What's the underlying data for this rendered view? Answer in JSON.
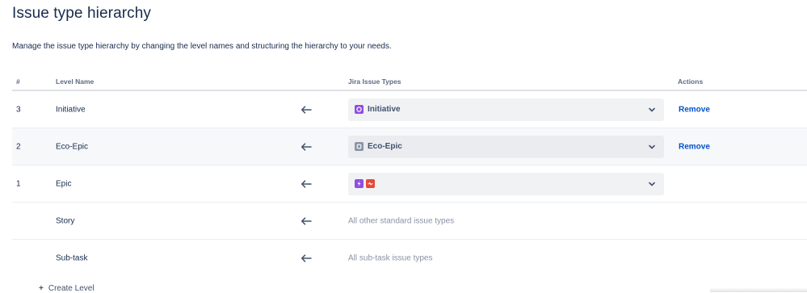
{
  "title": "Issue type hierarchy",
  "description": "Manage the issue type hierarchy by changing the level names and structuring the hierarchy to your needs.",
  "columns": {
    "num": "#",
    "level_name": "Level Name",
    "issue_types": "Jira Issue Types",
    "actions": "Actions"
  },
  "rows": [
    {
      "num": "3",
      "name": "Initiative",
      "arrow_icon": "arrow-left-icon",
      "type_label": "Initiative",
      "type_icons": [
        "initiative-icon"
      ],
      "action": "Remove"
    },
    {
      "num": "2",
      "name": "Eco-Epic",
      "arrow_icon": "arrow-left-icon",
      "type_label": "Eco-Epic",
      "type_icons": [
        "eco-epic-icon"
      ],
      "action": "Remove"
    },
    {
      "num": "1",
      "name": "Epic",
      "arrow_icon": "arrow-left-icon",
      "type_label": "",
      "type_icons": [
        "epic-icon",
        "bug-icon"
      ],
      "action": ""
    },
    {
      "num": "",
      "name": "Story",
      "arrow_icon": "arrow-left-icon",
      "types_text": "All other standard issue types"
    },
    {
      "num": "",
      "name": "Sub-task",
      "arrow_icon": "arrow-left-icon",
      "types_text": "All sub-task issue types"
    }
  ],
  "create_level": "Create Level",
  "colors": {
    "initiative": "#904ee2",
    "eco_epic": "#8993a4",
    "epic": "#904ee2",
    "bug": "#e5493a",
    "link": "#0052cc"
  }
}
